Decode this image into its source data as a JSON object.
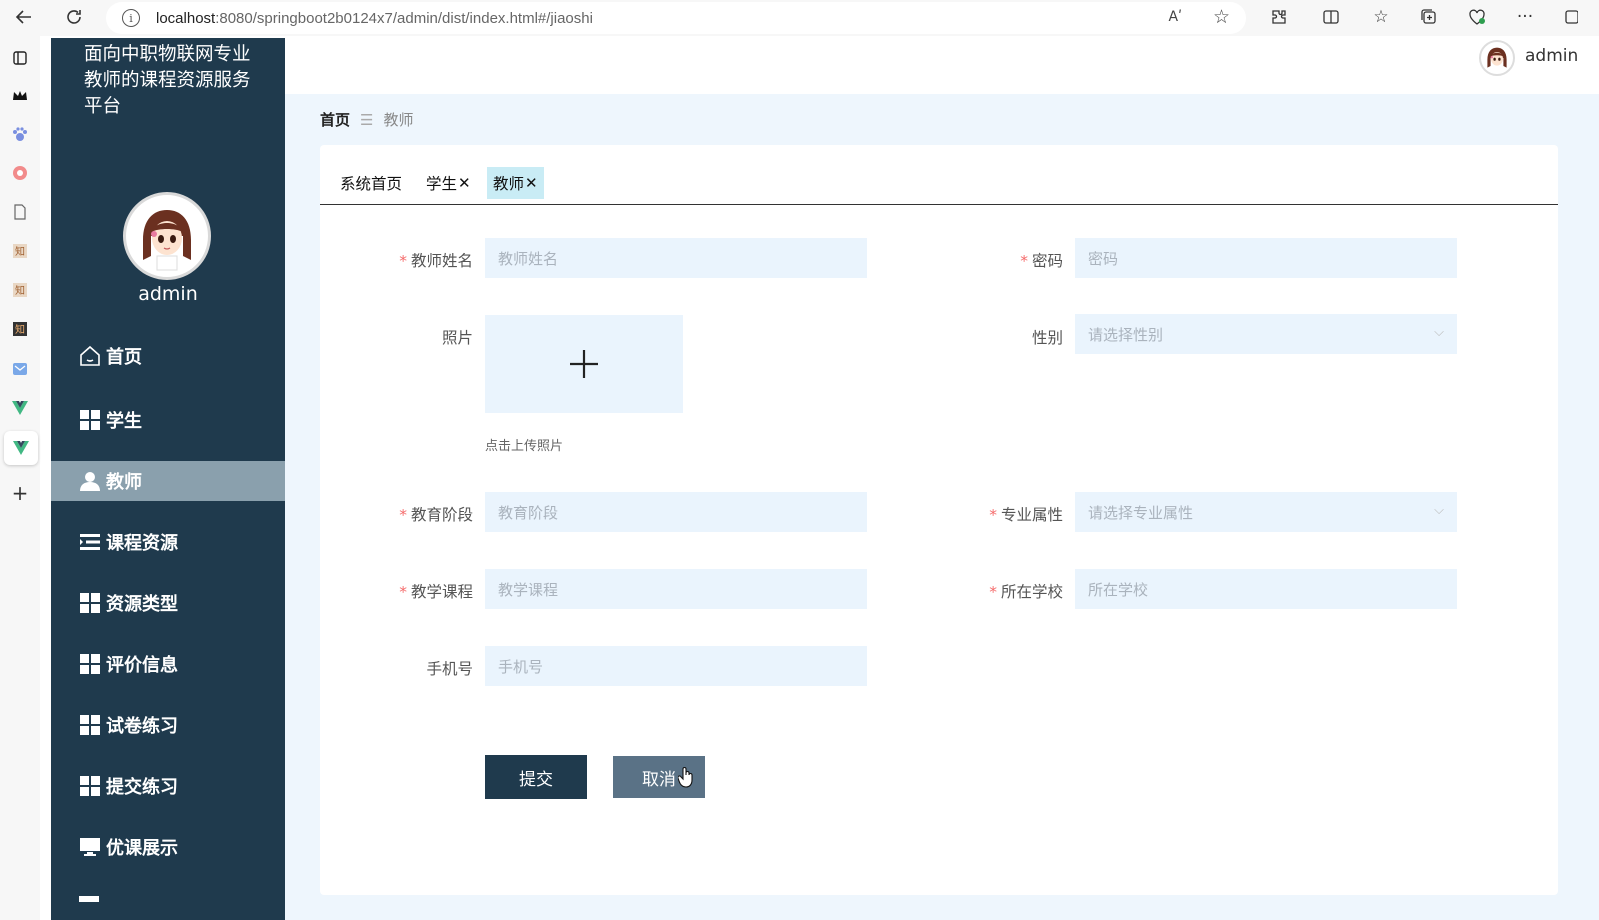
{
  "browser": {
    "url_host": "localhost",
    "url_rest": ":8080/springboot2b0124x7/admin/dist/index.html#/jiaoshi",
    "read_aloud": "Aʹ"
  },
  "sidebar": {
    "app_title": "面向中职物联网专业教师的课程资源服务平台",
    "username": "admin",
    "items": [
      {
        "label": "首页",
        "icon": "home-icon"
      },
      {
        "label": "学生",
        "icon": "grid-icon"
      },
      {
        "label": "教师",
        "icon": "user-icon"
      },
      {
        "label": "课程资源",
        "icon": "list-icon"
      },
      {
        "label": "资源类型",
        "icon": "grid-icon"
      },
      {
        "label": "评价信息",
        "icon": "grid-icon"
      },
      {
        "label": "试卷练习",
        "icon": "grid-icon"
      },
      {
        "label": "提交练习",
        "icon": "grid-icon"
      },
      {
        "label": "优课展示",
        "icon": "monitor-icon"
      }
    ]
  },
  "topbar": {
    "username": "admin"
  },
  "breadcrumb": {
    "home": "首页",
    "separator": "☰",
    "current": "教师"
  },
  "tabs": [
    {
      "label": "系统首页",
      "closable": false
    },
    {
      "label": "学生",
      "closable": true
    },
    {
      "label": "教师",
      "closable": true
    }
  ],
  "form": {
    "name": {
      "label": "教师姓名",
      "placeholder": "教师姓名",
      "required": true
    },
    "password": {
      "label": "密码",
      "placeholder": "密码",
      "required": true
    },
    "photo": {
      "label": "照片",
      "hint": "点击上传照片"
    },
    "gender": {
      "label": "性别",
      "placeholder": "请选择性别"
    },
    "stage": {
      "label": "教育阶段",
      "placeholder": "教育阶段",
      "required": true
    },
    "major": {
      "label": "专业属性",
      "placeholder": "请选择专业属性",
      "required": true
    },
    "course": {
      "label": "教学课程",
      "placeholder": "教学课程",
      "required": true
    },
    "school": {
      "label": "所在学校",
      "placeholder": "所在学校",
      "required": true
    },
    "phone": {
      "label": "手机号",
      "placeholder": "手机号"
    },
    "required_mark": "*",
    "submit_label": "提交",
    "cancel_label": "取消"
  },
  "colors": {
    "sidebar_bg": "#1f3a4d",
    "active_item": "#8aa0ad",
    "page_bg": "#eef6fd",
    "input_bg": "#eaf4fd",
    "required": "#f56c6c"
  }
}
